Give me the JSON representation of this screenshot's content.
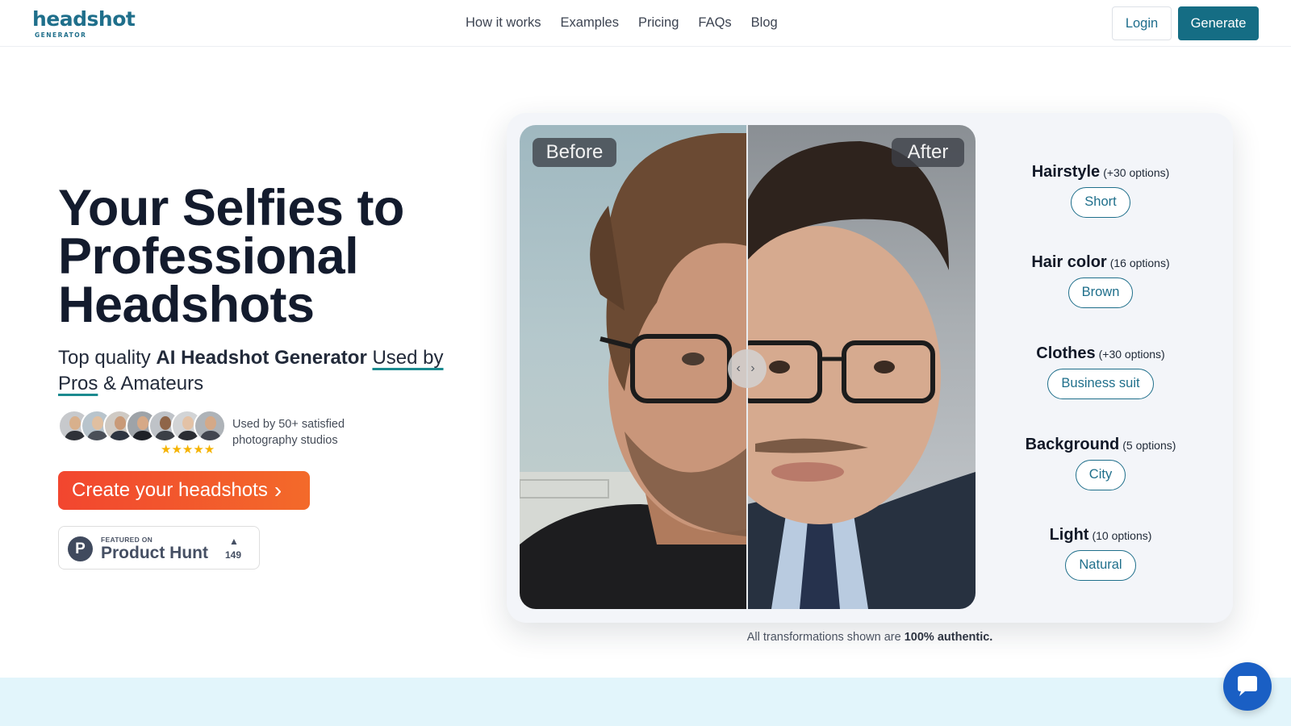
{
  "header": {
    "logo_main": "headshot",
    "logo_sub": "GENERATOR",
    "nav": [
      "How it works",
      "Examples",
      "Pricing",
      "FAQs",
      "Blog"
    ],
    "login": "Login",
    "generate": "Generate"
  },
  "hero": {
    "title_line1": "Your Selfies to",
    "title_line2": "Professional",
    "title_line3": "Headshots",
    "sub_part1": "Top quality ",
    "sub_bold": "AI Headshot Generator",
    "sub_ul1": "Used by",
    "sub_ul2": "Pros",
    "sub_part2": " & Amateurs",
    "stars": "★★★★★",
    "studios_text": "Used by 50+ satisfied photography studios",
    "cta": "Create your headshots",
    "cta_chevron": "›",
    "product_hunt": {
      "logo_letter": "P",
      "featured": "FEATURED ON",
      "name": "Product Hunt",
      "arrow": "▲",
      "count": "149"
    }
  },
  "compare": {
    "before_label": "Before",
    "after_label": "After",
    "handle_glyph": "‹ ›"
  },
  "options": [
    {
      "title": "Hairstyle",
      "count": "(+30 options)",
      "value": "Short"
    },
    {
      "title": "Hair color",
      "count": "(16 options)",
      "value": "Brown"
    },
    {
      "title": "Clothes",
      "count": "(+30 options)",
      "value": "Business suit"
    },
    {
      "title": "Background",
      "count": "(5 options)",
      "value": "City"
    },
    {
      "title": "Light",
      "count": "(10 options)",
      "value": "Natural"
    }
  ],
  "authentic": {
    "text": "All transformations shown are ",
    "bold": "100% authentic."
  },
  "colors": {
    "brand": "#1f6f8b",
    "cta_start": "#f2462f",
    "cta_end": "#f36a2a",
    "chat": "#1a5fc4",
    "band": "#e2f5fb"
  }
}
